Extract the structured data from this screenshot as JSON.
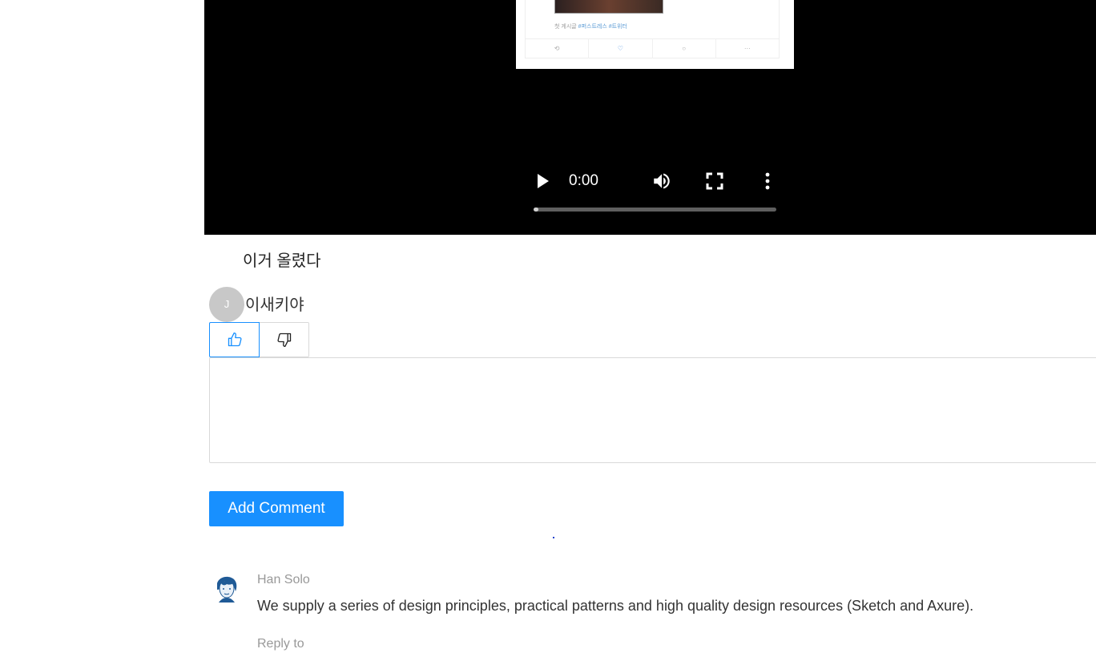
{
  "video": {
    "embedded_post": {
      "caption_prefix": "첫 게시글",
      "hashtags": "#퍼스트레스 #트위터",
      "actions": [
        "⟲",
        "♡",
        "○",
        "···"
      ]
    },
    "player": {
      "current_time": "0:00",
      "progress": 0.02
    }
  },
  "post": {
    "text": "이거 올렸다"
  },
  "comment": {
    "avatar_initial": "J",
    "text": "이새키야"
  },
  "votes": {
    "like_icon": "thumbs-up-icon",
    "dislike_icon": "thumbs-down-icon"
  },
  "comment_form": {
    "textarea_value": "",
    "submit_label": "Add Comment"
  },
  "comments": [
    {
      "author": "Han Solo",
      "content": "We supply a series of design principles, practical patterns and high quality design resources (Sketch and Axure).",
      "action": "Reply to"
    }
  ],
  "colors": {
    "primary": "#1890ff",
    "muted": "#999999",
    "video_bg": "#000000"
  }
}
